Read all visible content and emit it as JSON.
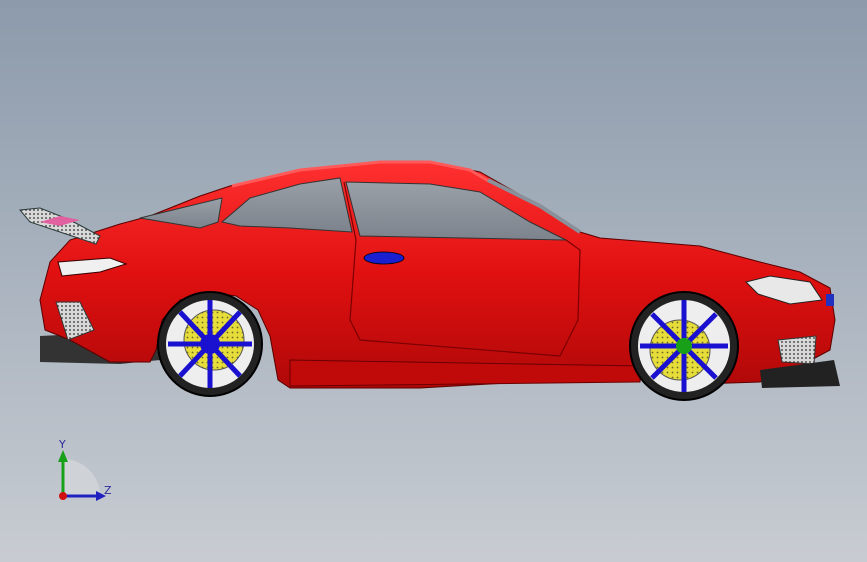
{
  "viewport": {
    "background_top": "#8c9aab",
    "background_bottom": "#c8ccd2"
  },
  "model": {
    "name": "sports-coupe-side-view",
    "body_color": "#e01010",
    "rim_color": "#1a10d0",
    "caliper_color": "#e0d840",
    "glass_color": "#8a9099"
  },
  "triad": {
    "y_label": "Y",
    "z_label": "Z",
    "y_color": "#18a018",
    "z_color": "#2020c0",
    "x_color": "#d01010"
  }
}
